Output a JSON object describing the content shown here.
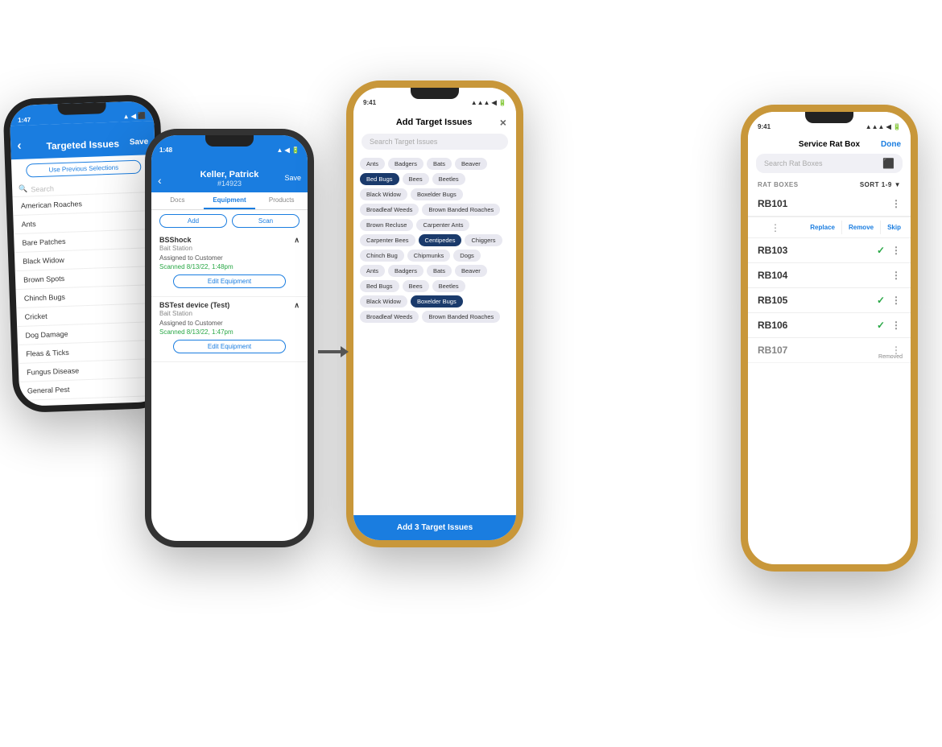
{
  "phone1": {
    "time": "1:47",
    "title": "Targeted Issues",
    "save": "Save",
    "prev_btn": "Use Previous Selections",
    "search_placeholder": "Search",
    "list_items": [
      "American Roaches",
      "Ants",
      "Bare Patches",
      "Black Widow",
      "Brown Spots",
      "Chinch Bugs",
      "Cricket",
      "Dog Damage",
      "Fleas & Ticks",
      "Fungus Disease",
      "General Pest"
    ]
  },
  "phone2": {
    "time": "1:48",
    "customer_name": "Keller, Patrick",
    "customer_id": "#14923",
    "save": "Save",
    "tabs": [
      "Docs",
      "Equipment",
      "Products"
    ],
    "active_tab": "Equipment",
    "add_btn": "Add",
    "scan_btn": "Scan",
    "equipment": [
      {
        "name": "BSShock",
        "type": "Bait Station",
        "assigned": "Assigned to Customer",
        "scanned": "Scanned 8/13/22, 1:48pm",
        "edit_btn": "Edit Equipment"
      },
      {
        "name": "BSTest device (Test)",
        "type": "Bait Station",
        "assigned": "Assigned to Customer",
        "scanned": "Scanned 8/13/22, 1:47pm",
        "edit_btn": "Edit Equipment"
      }
    ]
  },
  "phone3": {
    "time": "9:41",
    "title": "Add Target Issues",
    "close": "×",
    "search_placeholder": "Search Target Issues",
    "tags_row1": [
      "Ants",
      "Badgers",
      "Bats",
      "Beaver"
    ],
    "tags_row2": [
      "Bed Bugs",
      "Bees",
      "Beetles"
    ],
    "tags_row3": [
      "Black Widow",
      "Boxelder Bugs"
    ],
    "tags_row4": [
      "Broadleaf Weeds",
      "Brown Banded Roaches"
    ],
    "tags_row5": [
      "Brown Recluse",
      "Carpenter Ants"
    ],
    "tags_row6": [
      "Carpenter Bees",
      "Centipedes",
      "Chiggers"
    ],
    "tags_row7": [
      "Chinch Bug",
      "Chipmunks",
      "Dogs"
    ],
    "tags_row8": [
      "Ants",
      "Badgers",
      "Bats",
      "Beaver"
    ],
    "tags_row9": [
      "Bed Bugs",
      "Bees",
      "Beetles"
    ],
    "tags_row10": [
      "Black Widow",
      "Boxelder Bugs"
    ],
    "tags_row11": [
      "Broadleaf Weeds",
      "Brown Banded Roaches"
    ],
    "selected_tags": [
      "Bed Bugs",
      "Centipedes",
      "Boxelder Bugs"
    ],
    "add_btn": "Add 3 Target Issues"
  },
  "phone4": {
    "time": "9:41",
    "title": "Service Rat Box",
    "done": "Done",
    "search_placeholder": "Search Rat Boxes",
    "section_label": "RAT BOXES",
    "sort_label": "SORT 1-9",
    "items": [
      {
        "id": "RB101",
        "checked": false,
        "removed": false
      },
      {
        "id": "RB103",
        "checked": true,
        "removed": false
      },
      {
        "id": "RB104",
        "checked": false,
        "removed": false
      },
      {
        "id": "RB105",
        "checked": true,
        "removed": false
      },
      {
        "id": "RB106",
        "checked": true,
        "removed": false
      },
      {
        "id": "RB107",
        "checked": false,
        "removed": true
      }
    ],
    "context_menu": {
      "replace": "Replace",
      "remove": "Remove",
      "skip": "Skip"
    }
  },
  "arrow": "→"
}
